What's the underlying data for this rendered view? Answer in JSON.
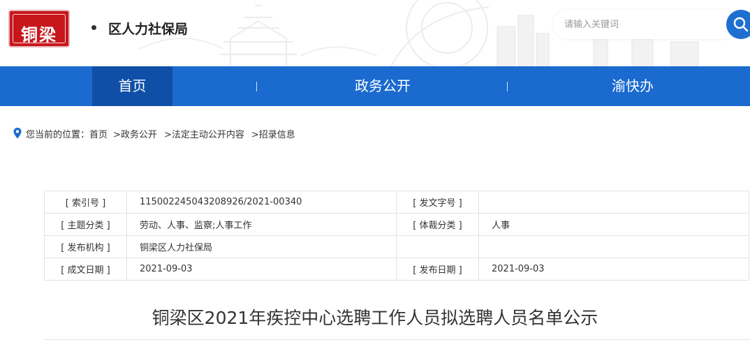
{
  "header": {
    "logo_text": "铜梁",
    "site_name": "区人力社保局",
    "search_placeholder": "请输入关键词"
  },
  "nav": {
    "items": [
      {
        "label": "首页",
        "active": true
      },
      {
        "label": "政务公开",
        "active": false
      },
      {
        "label": "渝快办",
        "active": false
      }
    ]
  },
  "breadcrumb": {
    "prefix": "您当前的位置：",
    "items": [
      "首页",
      ">政务公开",
      ">法定主动公开内容",
      ">招录信息"
    ]
  },
  "meta": {
    "index_label": "[ 索引号 ]",
    "index_value": "115002245043208926/2021-00340",
    "doc_no_label": "[ 发文字号 ]",
    "doc_no_value": "",
    "topic_label": "[ 主题分类 ]",
    "topic_value": "劳动、人事、监察;人事工作",
    "genre_label": "[ 体裁分类 ]",
    "genre_value": "人事",
    "org_label": "[ 发布机构 ]",
    "org_value": "铜梁区人力社保局",
    "created_label": "[ 成文日期 ]",
    "created_value": "2021-09-03",
    "published_label": "[ 发布日期 ]",
    "published_value": "2021-09-03"
  },
  "article": {
    "title": "铜梁区2021年疾控中心选聘工作人员拟选聘人员名单公示"
  }
}
